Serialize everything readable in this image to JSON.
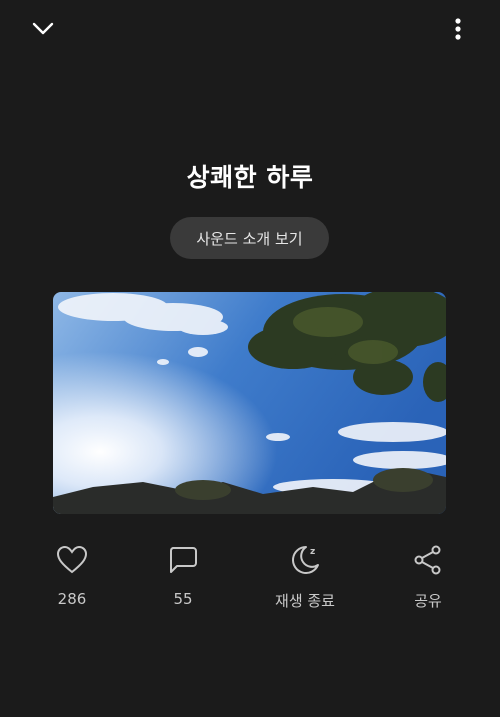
{
  "header": {
    "back_icon": "chevron-down-icon",
    "menu_icon": "more-vertical-icon"
  },
  "title": "상쾌한 하루",
  "sound_button_label": "사운드 소개 보기",
  "image": {
    "subject": "sky-with-trees"
  },
  "actions": {
    "like": {
      "icon": "heart-icon",
      "label": "286"
    },
    "comment": {
      "icon": "comment-icon",
      "label": "55"
    },
    "sleep": {
      "icon": "moon-sleep-icon",
      "label": "재생 종료"
    },
    "share": {
      "icon": "share-icon",
      "label": "공유"
    }
  },
  "colors": {
    "background": "#1b1b1b",
    "button_bg": "#3a3a3a",
    "icon": "#c8c8c8"
  }
}
